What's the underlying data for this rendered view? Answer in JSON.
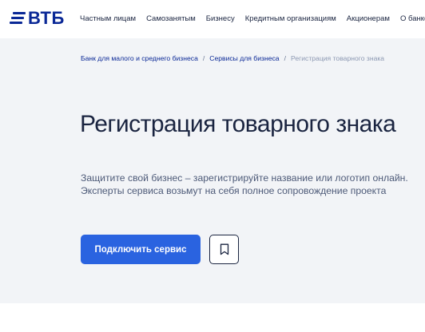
{
  "brand": {
    "name": "ВТБ",
    "color": "#0a2896"
  },
  "nav": {
    "items": [
      {
        "label": "Частным лицам"
      },
      {
        "label": "Самозанятым"
      },
      {
        "label": "Бизнесу"
      },
      {
        "label": "Кредитным организациям"
      },
      {
        "label": "Акционерам"
      },
      {
        "label": "О банке"
      }
    ]
  },
  "breadcrumb": {
    "items": [
      {
        "label": "Банк для малого и среднего бизнеса"
      },
      {
        "label": "Сервисы для бизнеса"
      }
    ],
    "current": "Регистрация товарного знака",
    "separator": "/"
  },
  "hero": {
    "title": "Регистрация товарного знака",
    "subtitle": "Защитите свой бизнес – зарегистрируйте название или логотип онлайн. Эксперты сервиса возьмут на себя полное сопровождение проекта",
    "cta_label": "Подключить сервис",
    "bookmark_icon": "bookmark-icon"
  },
  "colors": {
    "accent": "#2a63e0",
    "hero_bg": "#f2f4f7",
    "text": "#1a2440"
  }
}
